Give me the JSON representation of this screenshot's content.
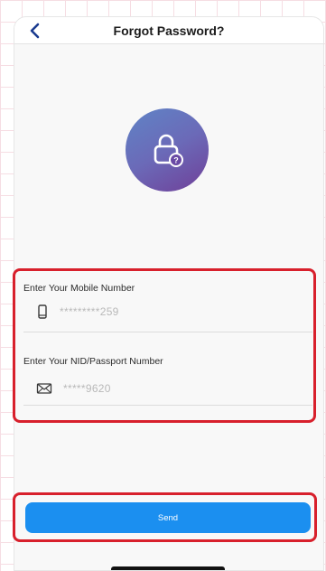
{
  "header": {
    "title": "Forgot Password?",
    "back_icon": "chevron-left-icon"
  },
  "hero": {
    "icon": "lock-question-icon"
  },
  "form": {
    "mobile": {
      "label": "Enter Your Mobile Number",
      "icon": "phone-icon",
      "value": "*********259"
    },
    "nid": {
      "label": "Enter Your NID/Passport Number",
      "icon": "id-card-icon",
      "value": "*****9620"
    }
  },
  "actions": {
    "send_label": "Send"
  },
  "colors": {
    "accent": "#1b8ff0",
    "highlight": "#d8202c",
    "hero_gradient_start": "#5f84c6",
    "hero_gradient_end": "#6f3f98"
  }
}
